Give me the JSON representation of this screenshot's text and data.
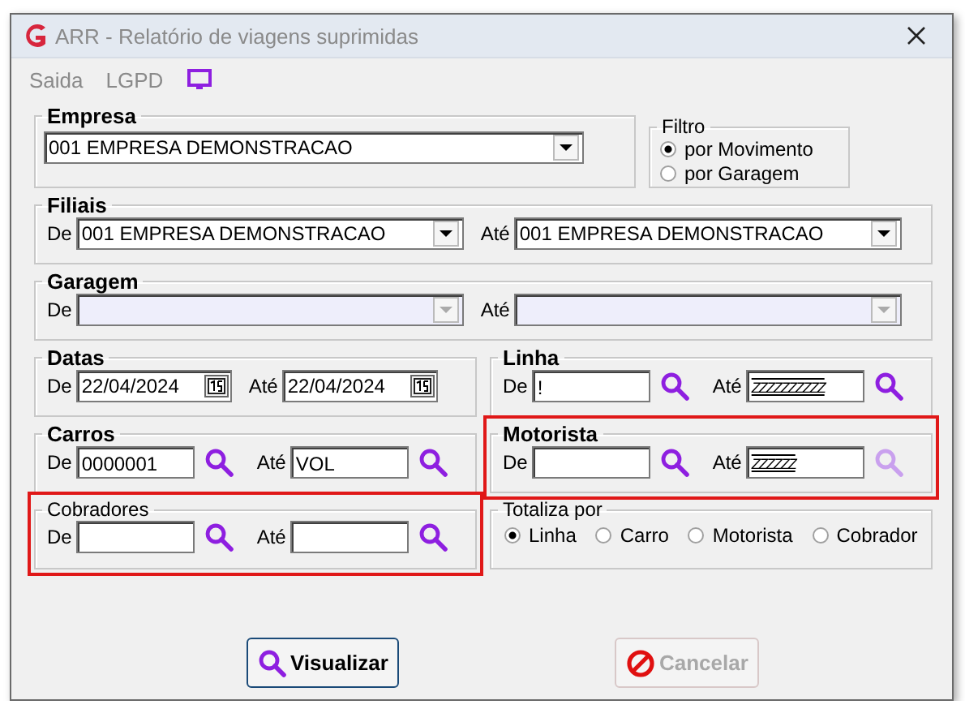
{
  "window": {
    "title": "ARR - Relatório de viagens suprimidas"
  },
  "menu": [
    {
      "label": "Saida"
    },
    {
      "label": "LGPD"
    }
  ],
  "empresa": {
    "label": "Empresa",
    "value": "001 EMPRESA DEMONSTRACAO"
  },
  "filtro": {
    "label": "Filtro",
    "options": [
      {
        "label": "por Movimento",
        "selected": true
      },
      {
        "label": "por Garagem",
        "selected": false
      }
    ]
  },
  "ranges": [
    {
      "title": "Filiais",
      "title_bold": true,
      "highlighted": false,
      "kind": "combo",
      "from": {
        "label": "De",
        "value": "001 EMPRESA DEMONSTRACAO",
        "disabled": false
      },
      "to": {
        "label": "Até",
        "value": "001 EMPRESA DEMONSTRACAO",
        "disabled": false
      }
    },
    {
      "title": "Garagem",
      "title_bold": true,
      "highlighted": false,
      "kind": "combo",
      "from": {
        "label": "De",
        "disabled": true
      },
      "to": {
        "label": "Até",
        "disabled": true
      }
    },
    {
      "title": "Datas",
      "title_bold": true,
      "highlighted": false,
      "kind": "date",
      "from": {
        "label": "De",
        "value": "22/04/2024",
        "disabled": false
      },
      "to": {
        "label": "Até",
        "value": "22/04/2024",
        "disabled": false
      }
    },
    {
      "title": "Linha",
      "title_bold": true,
      "highlighted": false,
      "kind": "lookup",
      "from": {
        "label": "De",
        "value": "!",
        "disabled": false
      },
      "to": {
        "label": "Até",
        "value": "ZZZZZZZZZZ",
        "hatched": true,
        "disabled": false
      }
    },
    {
      "title": "Carros",
      "title_bold": true,
      "highlighted": false,
      "kind": "lookup",
      "from": {
        "label": "De",
        "value": "0000001",
        "disabled": false
      },
      "to": {
        "label": "Até",
        "value": "VOL",
        "disabled": false
      }
    },
    {
      "title": "Motorista",
      "title_bold": true,
      "highlighted": true,
      "kind": "lookup",
      "from": {
        "label": "De",
        "disabled": false
      },
      "to": {
        "label": "Até",
        "value": "ZZZZZZ",
        "hatched": true,
        "disabled": true
      }
    },
    {
      "title": "Cobradores",
      "title_bold": false,
      "highlighted": true,
      "kind": "lookup",
      "from": {
        "label": "De",
        "disabled": false
      },
      "to": {
        "label": "Até",
        "disabled": false
      }
    }
  ],
  "totaliza": {
    "label": "Totaliza por",
    "options": [
      {
        "label": "Linha",
        "selected": true
      },
      {
        "label": "Carro",
        "selected": false
      },
      {
        "label": "Motorista",
        "selected": false
      },
      {
        "label": "Cobrador",
        "selected": false
      }
    ]
  },
  "buttons": [
    {
      "label": "Visualizar",
      "kind": "search",
      "disabled": false
    },
    {
      "label": "Cancelar",
      "kind": "cancel",
      "disabled": true
    }
  ]
}
